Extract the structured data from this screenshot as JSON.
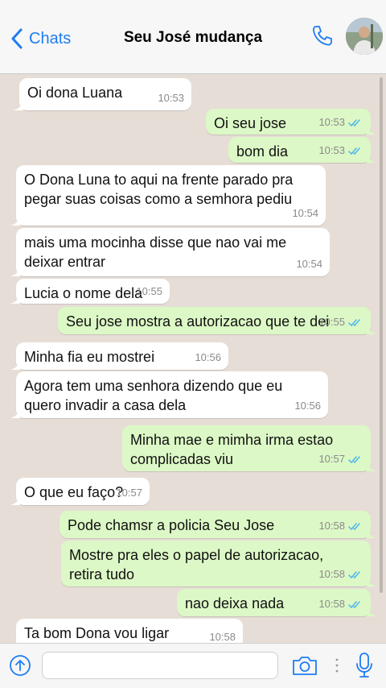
{
  "header": {
    "back_label": "Chats",
    "title": "Seu José mudança"
  },
  "messages": [
    {
      "dir": "in",
      "text": "Oi dona Luana",
      "time": "10:53"
    },
    {
      "dir": "out",
      "text": "Oi seu jose",
      "time": "10:53",
      "ticks": "read"
    },
    {
      "dir": "out",
      "text": "bom dia",
      "time": "10:53",
      "ticks": "read"
    },
    {
      "dir": "in",
      "text": "O Dona Luna to aqui na frente parado pra\npegar suas coisas como a semhora pediu",
      "time": "10:54"
    },
    {
      "dir": "in",
      "text": "mais uma mocinha disse que nao vai me\ndeixar entrar",
      "time": "10:54"
    },
    {
      "dir": "in",
      "text": "Lucia o nome dela",
      "time": "10:55"
    },
    {
      "dir": "out",
      "text": "Seu jose mostra a autorizacao que te dei",
      "time": "10:55",
      "ticks": "read"
    },
    {
      "dir": "in",
      "text": "Minha fia eu mostrei",
      "time": "10:56"
    },
    {
      "dir": "in",
      "text": "Agora tem uma senhora dizendo que eu\nquero invadir a casa dela",
      "time": "10:56"
    },
    {
      "dir": "out",
      "text": "Minha mae e mimha irma estao\ncomplicadas viu",
      "time": "10:57",
      "ticks": "read"
    },
    {
      "dir": "in",
      "text": "O que eu faço?",
      "time": "10:57"
    },
    {
      "dir": "out",
      "text": "Pode chamsr a policia Seu Jose",
      "time": "10:58",
      "ticks": "read"
    },
    {
      "dir": "out",
      "text": "Mostre pra eles o papel de autorizacao,\nretira tudo",
      "time": "10:58",
      "ticks": "read"
    },
    {
      "dir": "out",
      "text": "nao deixa nada",
      "time": "10:58",
      "ticks": "read"
    },
    {
      "dir": "in",
      "text": "Ta bom Dona vou ligar",
      "time": "10:58"
    }
  ],
  "input": {
    "placeholder": ""
  },
  "icons": {
    "back": "chevron-left-icon",
    "call": "phone-icon",
    "contact": "avatar",
    "attach": "plus-circle-icon",
    "camera": "camera-icon",
    "voice": "microphone-icon",
    "read_receipt": "double-check-icon"
  },
  "colors": {
    "accent": "#1e7cf2",
    "incoming_bubble": "#ffffff",
    "outgoing_bubble": "#dcf8c6",
    "chat_background": "#e6ded6",
    "read_ticks": "#4fb6ec"
  }
}
